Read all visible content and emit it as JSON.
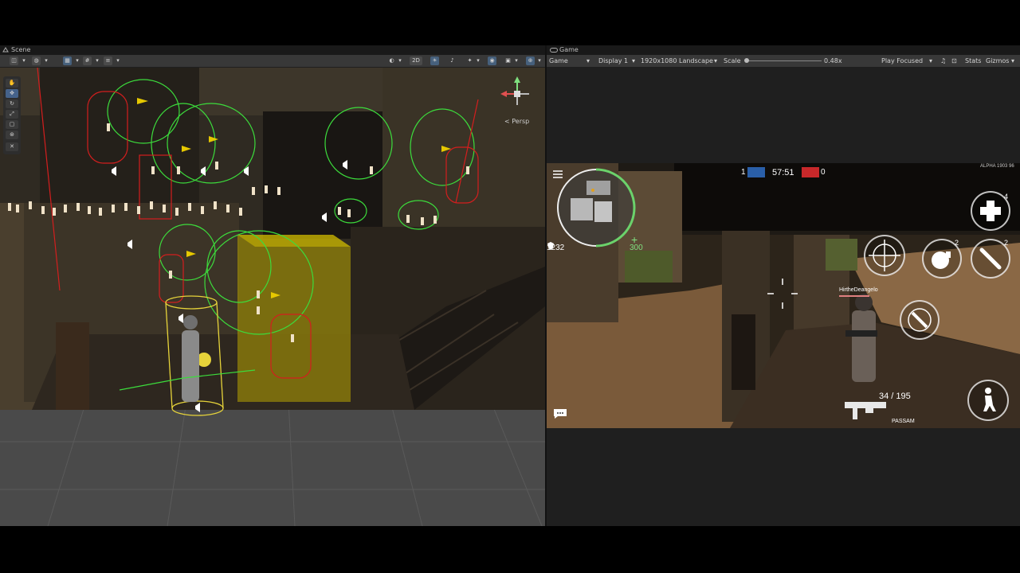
{
  "scene": {
    "tab_label": "Scene",
    "toolbar": {
      "mode_2d": "2D"
    },
    "persp_label": "< Persp"
  },
  "game": {
    "tab_label": "Game",
    "toolbar": {
      "view_select": "Game",
      "display_select": "Display 1",
      "resolution_select": "1920x1080 Landscape",
      "scale_label": "Scale",
      "scale_value": "0.48x",
      "play_focused": "Play Focused",
      "stats": "Stats",
      "gizmos": "Gizmos"
    },
    "hud": {
      "team1_score": "1",
      "timer": "57:51",
      "team2_score": "0",
      "build_label": "ALPHA 1903 96",
      "armor_value": "1232",
      "health_value": "300",
      "player_name": "HirtheDeangelo",
      "ammo": "34 / 195",
      "weapon_name": "PASSAM",
      "medkit_count": "4",
      "grenade_count": "2",
      "knife_count": "2"
    }
  },
  "colors": {
    "editor_bg": "#282828",
    "toolbar_bg": "#383838",
    "gizmo_green": "#3cdc3c",
    "gizmo_red": "#d41e1e",
    "trigger_yellow": "#b8a400",
    "health_green": "#7fe07f"
  },
  "icons": [
    "hand-tool-icon",
    "move-tool-icon",
    "rotate-tool-icon",
    "scale-tool-icon",
    "rect-tool-icon",
    "transform-tool-icon",
    "custom-tool-icon",
    "lighting-icon",
    "audio-icon",
    "effects-icon",
    "visibility-icon",
    "camera-icon",
    "gizmo-icon",
    "menu-icon",
    "chat-icon",
    "medkit-icon",
    "scope-icon",
    "grenade-icon",
    "knife-icon",
    "prone-icon",
    "weapon-icon"
  ]
}
